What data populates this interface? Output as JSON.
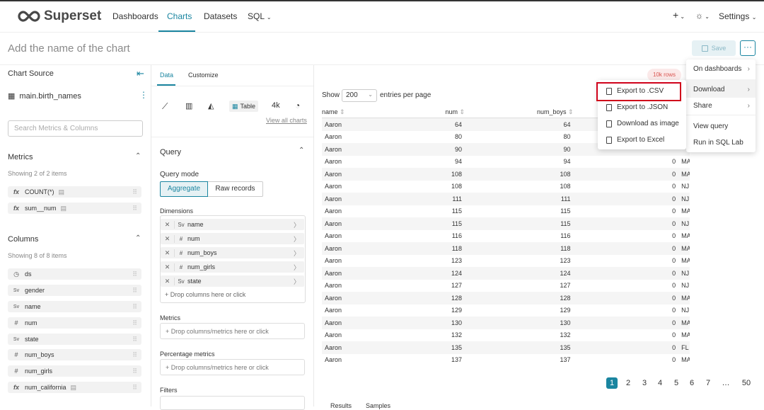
{
  "nav": {
    "brand": "Superset",
    "items": [
      "Dashboards",
      "Charts",
      "Datasets",
      "SQL"
    ],
    "plus": "+",
    "settings": "Settings"
  },
  "header": {
    "title_placeholder": "Add the name of the chart",
    "save": "Save",
    "more": "···"
  },
  "left": {
    "chart_source": "Chart Source",
    "dataset": "main.birth_names",
    "search_placeholder": "Search Metrics & Columns",
    "metrics_title": "Metrics",
    "metrics_count": "Showing 2 of 2 items",
    "metrics": [
      "COUNT(*)",
      "sum__num"
    ],
    "columns_title": "Columns",
    "columns_count": "Showing 8 of 8 items",
    "columns": [
      {
        "name": "ds",
        "icon": "clock-icon"
      },
      {
        "name": "gender",
        "icon": "string-type-icon"
      },
      {
        "name": "name",
        "icon": "string-type-icon"
      },
      {
        "name": "num",
        "icon": "hash-icon"
      },
      {
        "name": "state",
        "icon": "string-type-icon"
      },
      {
        "name": "num_boys",
        "icon": "hash-icon"
      },
      {
        "name": "num_girls",
        "icon": "hash-icon"
      },
      {
        "name": "num_california",
        "icon": "function-icon"
      }
    ]
  },
  "middle": {
    "tabs": [
      "Data",
      "Customize"
    ],
    "table_label": "Table",
    "big_number": "4k",
    "view_all": "View all charts",
    "query": "Query",
    "query_mode": "Query mode",
    "modes": [
      "Aggregate",
      "Raw records"
    ],
    "dimensions_title": "Dimensions",
    "dimensions": [
      {
        "type": "Sv",
        "name": "name"
      },
      {
        "type": "#",
        "name": "num"
      },
      {
        "type": "#",
        "name": "num_boys"
      },
      {
        "type": "#",
        "name": "num_girls"
      },
      {
        "type": "Sv",
        "name": "state"
      }
    ],
    "drop_columns": "+ Drop columns here or click",
    "metrics_title": "Metrics",
    "drop_metrics": "+ Drop columns/metrics here or click",
    "pct_title": "Percentage metrics",
    "drop_pct": "+ Drop columns/metrics here or click",
    "filters_title": "Filters"
  },
  "results": {
    "row_badge": "10k rows",
    "show": "Show",
    "page_size": "200",
    "entries": "entries per page",
    "headers": [
      "name",
      "num",
      "num_boys",
      "",
      ""
    ],
    "rows": [
      [
        "Aaron",
        "64",
        "64",
        "",
        ""
      ],
      [
        "Aaron",
        "80",
        "80",
        "",
        ""
      ],
      [
        "Aaron",
        "90",
        "90",
        "",
        ""
      ],
      [
        "Aaron",
        "94",
        "94",
        "0",
        "MA"
      ],
      [
        "Aaron",
        "108",
        "108",
        "0",
        "MA"
      ],
      [
        "Aaron",
        "108",
        "108",
        "0",
        "NJ"
      ],
      [
        "Aaron",
        "111",
        "111",
        "0",
        "NJ"
      ],
      [
        "Aaron",
        "115",
        "115",
        "0",
        "MA"
      ],
      [
        "Aaron",
        "115",
        "115",
        "0",
        "NJ"
      ],
      [
        "Aaron",
        "116",
        "116",
        "0",
        "MA"
      ],
      [
        "Aaron",
        "118",
        "118",
        "0",
        "MA"
      ],
      [
        "Aaron",
        "123",
        "123",
        "0",
        "MA"
      ],
      [
        "Aaron",
        "124",
        "124",
        "0",
        "NJ"
      ],
      [
        "Aaron",
        "127",
        "127",
        "0",
        "NJ"
      ],
      [
        "Aaron",
        "128",
        "128",
        "0",
        "MA"
      ],
      [
        "Aaron",
        "129",
        "129",
        "0",
        "NJ"
      ],
      [
        "Aaron",
        "130",
        "130",
        "0",
        "MA"
      ],
      [
        "Aaron",
        "132",
        "132",
        "0",
        "MA"
      ],
      [
        "Aaron",
        "135",
        "135",
        "0",
        "FL"
      ],
      [
        "Aaron",
        "137",
        "137",
        "0",
        "MA"
      ]
    ],
    "pages": [
      "1",
      "2",
      "3",
      "4",
      "5",
      "6",
      "7",
      "…",
      "50"
    ],
    "bottom_tabs": [
      "Results",
      "Samples"
    ]
  },
  "menu": {
    "main": [
      "On dashboards",
      "Download",
      "Share",
      "View query",
      "Run in SQL Lab"
    ],
    "sub": [
      "Export to .CSV",
      "Export to .JSON",
      "Download as image",
      "Export to Excel"
    ]
  },
  "colors": {
    "accent": "#1a85a0",
    "highlight": "#d0021b"
  }
}
